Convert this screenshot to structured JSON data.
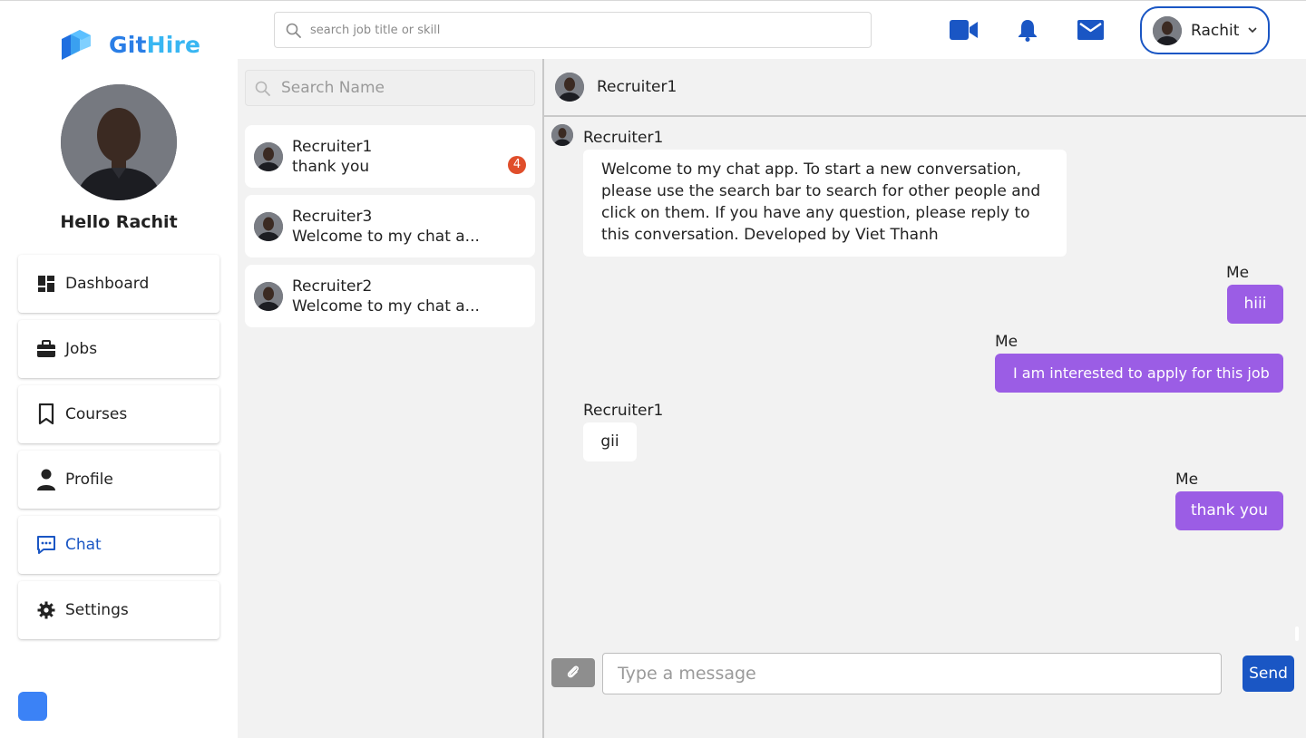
{
  "brand": {
    "part1": "Git",
    "part2": "Hire",
    "color_git": "#2a7ee6",
    "color_hire": "#38b6f2"
  },
  "top_bar": {
    "search_placeholder": "search job title or skill",
    "icons": [
      "video-camera-icon",
      "bell-icon",
      "mail-icon"
    ],
    "user_name": "Rachit"
  },
  "sidebar": {
    "greeting": "Hello Rachit",
    "nav": [
      {
        "label": "Dashboard",
        "icon": "dashboard-icon"
      },
      {
        "label": "Jobs",
        "icon": "briefcase-icon"
      },
      {
        "label": "Courses",
        "icon": "bookmark-icon"
      },
      {
        "label": "Profile",
        "icon": "person-icon"
      },
      {
        "label": "Chat",
        "icon": "chat-icon",
        "active": true
      },
      {
        "label": "Settings",
        "icon": "gear-icon"
      }
    ]
  },
  "conversations": {
    "search_placeholder": "Search Name",
    "items": [
      {
        "name": "Recruiter1",
        "preview": "thank you",
        "unread": "4"
      },
      {
        "name": "Recruiter3",
        "preview": "Welcome to my chat a..."
      },
      {
        "name": "Recruiter2",
        "preview": "Welcome to my chat a..."
      }
    ]
  },
  "chat": {
    "header_name": "Recruiter1",
    "messages": [
      {
        "sender": "Recruiter1",
        "direction": "in",
        "text": "Welcome to my chat app. To start a new conversation, please use the search bar to search for other people and click on them. If you have any question, please reply to this conversation. Developed by Viet Thanh"
      },
      {
        "sender": "Me",
        "direction": "out",
        "text": "hiii"
      },
      {
        "sender": "Me",
        "direction": "out",
        "text": "I am interested to apply for this job"
      },
      {
        "sender": "Recruiter1",
        "direction": "in",
        "text": "gii"
      },
      {
        "sender": "Me",
        "direction": "out",
        "text": "thank you"
      }
    ],
    "input_placeholder": "Type a message",
    "send_label": "Send"
  },
  "colors": {
    "primary": "#1a56c4",
    "outgoing_bubble": "#9b5de5",
    "badge": "#e04e2b",
    "panel_bg": "#f2f2f2"
  }
}
